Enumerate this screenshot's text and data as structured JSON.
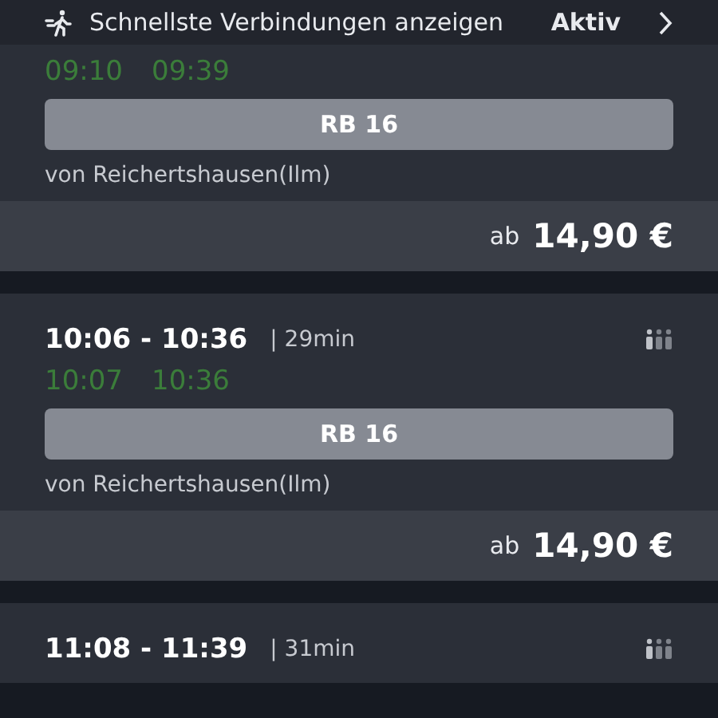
{
  "filter": {
    "label": "Schnellste Verbindungen anzeigen",
    "status": "Aktiv"
  },
  "connections": [
    {
      "realtime": [
        "09:10",
        "09:39"
      ],
      "train": "RB 16",
      "origin": "von Reichertshausen(Ilm)",
      "price_prefix": "ab",
      "price": "14,90 €"
    },
    {
      "times": "10:06 - 10:36",
      "duration": "| 29min",
      "realtime": [
        "10:07",
        "10:36"
      ],
      "train": "RB 16",
      "origin": "von Reichertshausen(Ilm)",
      "price_prefix": "ab",
      "price": "14,90 €"
    },
    {
      "times": "11:08 - 11:39",
      "duration": "| 31min"
    }
  ]
}
